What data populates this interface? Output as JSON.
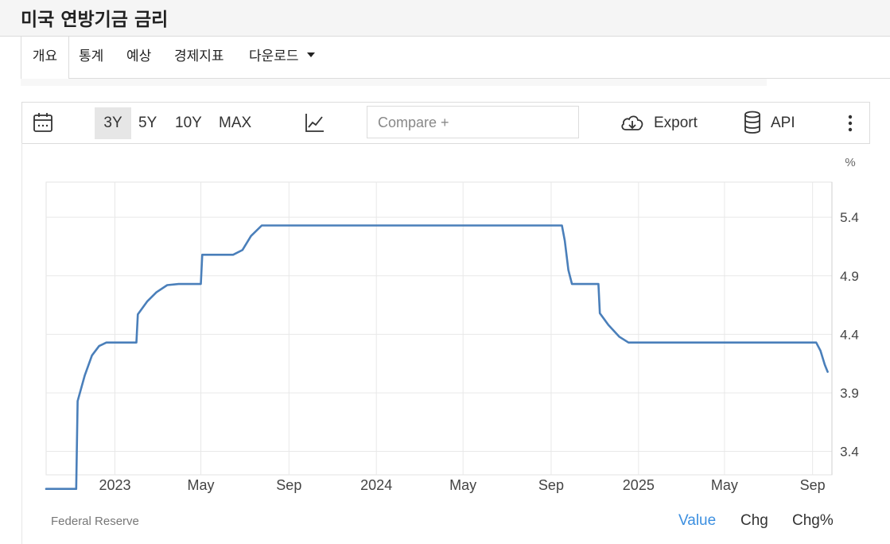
{
  "header": {
    "title": "미국 연방기금 금리"
  },
  "tabs": [
    {
      "label": "개요",
      "active": true
    },
    {
      "label": "통계"
    },
    {
      "label": "예상"
    },
    {
      "label": "경제지표"
    },
    {
      "label": "다운로드"
    }
  ],
  "toolbar": {
    "ranges": [
      {
        "label": "3Y",
        "active": true
      },
      {
        "label": "5Y"
      },
      {
        "label": "10Y"
      },
      {
        "label": "MAX"
      }
    ],
    "compare_placeholder": "Compare +",
    "export_label": "Export",
    "api_label": "API",
    "icons": [
      "calendar-icon",
      "line-chart-icon",
      "cloud-download-icon",
      "database-icon",
      "more-vertical-icon"
    ]
  },
  "footer": {
    "source": "Federal Reserve",
    "value_tabs": [
      {
        "label": "Value",
        "active": true
      },
      {
        "label": "Chg"
      },
      {
        "label": "Chg%"
      }
    ]
  },
  "colors": {
    "line": "#4a7fba",
    "active_tab": "#3c8fe0",
    "grid": "#e8e8e8"
  },
  "chart_data": {
    "type": "line",
    "title": "",
    "xlabel": "",
    "ylabel": "%",
    "ylim": [
      3.2,
      5.7
    ],
    "y_ticks": [
      3.4,
      3.9,
      4.4,
      4.9,
      5.4
    ],
    "x_range": [
      "2022-09-27",
      "2025-09-28"
    ],
    "x_ticks": [
      {
        "date": "2023-01-01",
        "label": "2023"
      },
      {
        "date": "2023-05-01",
        "label": "May"
      },
      {
        "date": "2023-09-01",
        "label": "Sep"
      },
      {
        "date": "2024-01-01",
        "label": "2024"
      },
      {
        "date": "2024-05-01",
        "label": "May"
      },
      {
        "date": "2024-09-01",
        "label": "Sep"
      },
      {
        "date": "2025-01-01",
        "label": "2025"
      },
      {
        "date": "2025-05-01",
        "label": "May"
      },
      {
        "date": "2025-09-01",
        "label": "Sep"
      }
    ],
    "grid": true,
    "series": [
      {
        "points": [
          [
            "2022-09-27",
            3.08
          ],
          [
            "2022-11-08",
            3.08
          ],
          [
            "2022-11-10",
            3.83
          ],
          [
            "2022-11-20",
            4.05
          ],
          [
            "2022-11-30",
            4.22
          ],
          [
            "2022-12-10",
            4.3
          ],
          [
            "2022-12-20",
            4.33
          ],
          [
            "2023-01-31",
            4.33
          ],
          [
            "2023-02-02",
            4.57
          ],
          [
            "2023-02-15",
            4.68
          ],
          [
            "2023-02-28",
            4.76
          ],
          [
            "2023-03-15",
            4.82
          ],
          [
            "2023-03-31",
            4.83
          ],
          [
            "2023-05-01",
            4.83
          ],
          [
            "2023-05-03",
            5.08
          ],
          [
            "2023-06-15",
            5.08
          ],
          [
            "2023-06-28",
            5.12
          ],
          [
            "2023-07-10",
            5.24
          ],
          [
            "2023-07-25",
            5.33
          ],
          [
            "2024-09-16",
            5.33
          ],
          [
            "2024-09-20",
            5.2
          ],
          [
            "2024-09-25",
            4.95
          ],
          [
            "2024-09-30",
            4.83
          ],
          [
            "2024-11-06",
            4.83
          ],
          [
            "2024-11-08",
            4.58
          ],
          [
            "2024-11-20",
            4.48
          ],
          [
            "2024-12-05",
            4.38
          ],
          [
            "2024-12-18",
            4.33
          ],
          [
            "2025-09-01",
            4.33
          ],
          [
            "2025-09-06",
            4.33
          ],
          [
            "2025-09-12",
            4.26
          ],
          [
            "2025-09-18",
            4.14
          ],
          [
            "2025-09-22",
            4.08
          ]
        ]
      }
    ]
  }
}
